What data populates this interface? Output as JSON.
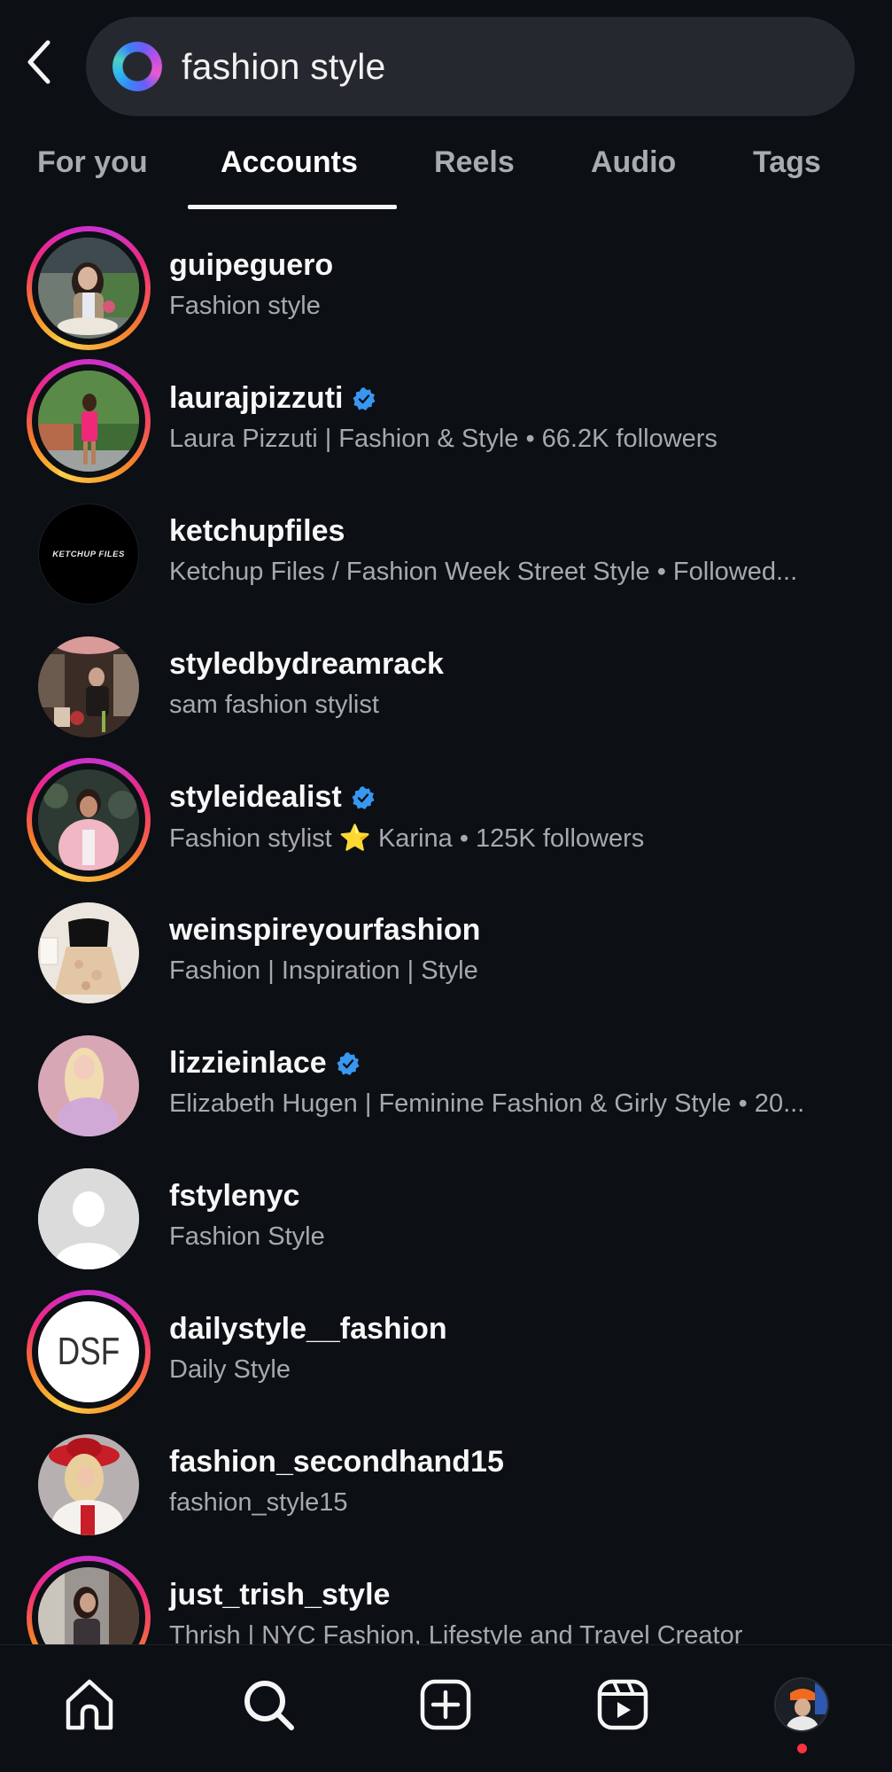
{
  "header": {
    "back_label": "Back",
    "search_query": "fashion style",
    "search_icon": "meta-ai-ring-icon"
  },
  "tabs": [
    {
      "label": "For you",
      "active": false
    },
    {
      "label": "Accounts",
      "active": true
    },
    {
      "label": "Reels",
      "active": false
    },
    {
      "label": "Audio",
      "active": false
    },
    {
      "label": "Tags",
      "active": false
    }
  ],
  "accounts": [
    {
      "username": "guipeguero",
      "subtitle": "Fashion style",
      "verified": false,
      "story_ring": true,
      "avatar": "photo"
    },
    {
      "username": "laurajpizzuti",
      "subtitle": "Laura Pizzuti | Fashion & Style • 66.2K followers",
      "verified": true,
      "story_ring": true,
      "avatar": "photo"
    },
    {
      "username": "ketchupfiles",
      "subtitle": "Ketchup Files / Fashion Week Street Style • Followed...",
      "verified": false,
      "story_ring": false,
      "avatar": "logo",
      "avatar_text": "KETCHUP FILES"
    },
    {
      "username": "styledbydreamrack",
      "subtitle": "sam fashion stylist",
      "verified": false,
      "story_ring": false,
      "avatar": "photo"
    },
    {
      "username": "styleidealist",
      "subtitle": "Fashion stylist ⭐ Karina • 125K followers",
      "verified": true,
      "story_ring": true,
      "avatar": "photo"
    },
    {
      "username": "weinspireyourfashion",
      "subtitle": "Fashion | Inspiration | Style",
      "verified": false,
      "story_ring": false,
      "avatar": "photo"
    },
    {
      "username": "lizzieinlace",
      "subtitle": "Elizabeth Hugen | Feminine Fashion & Girly Style • 20...",
      "verified": true,
      "story_ring": false,
      "avatar": "photo"
    },
    {
      "username": "fstylenyc",
      "subtitle": "Fashion Style",
      "verified": false,
      "story_ring": false,
      "avatar": "default"
    },
    {
      "username": "dailystyle__fashion",
      "subtitle": "Daily Style",
      "verified": false,
      "story_ring": true,
      "avatar": "logo",
      "avatar_text": "DSF"
    },
    {
      "username": "fashion_secondhand15",
      "subtitle": "fashion_style15",
      "verified": false,
      "story_ring": false,
      "avatar": "photo"
    },
    {
      "username": "just_trish_style",
      "subtitle": "Thrish | NYC Fashion, Lifestyle and Travel Creator",
      "verified": false,
      "story_ring": true,
      "avatar": "photo"
    }
  ],
  "bottom_nav": [
    {
      "label": "Home",
      "icon": "home-icon"
    },
    {
      "label": "Search",
      "icon": "search-icon",
      "active": true
    },
    {
      "label": "Create",
      "icon": "create-icon"
    },
    {
      "label": "Reels",
      "icon": "reels-icon"
    },
    {
      "label": "Profile",
      "icon": "profile-avatar",
      "notification_dot": true
    }
  ],
  "colors": {
    "background": "#0c0f14",
    "search_bg": "#25292f",
    "verified_blue": "#3897f0",
    "notification_red": "#ff3040",
    "tab_inactive": "#a8abb0",
    "subtitle_gray": "#a6a9ae"
  }
}
